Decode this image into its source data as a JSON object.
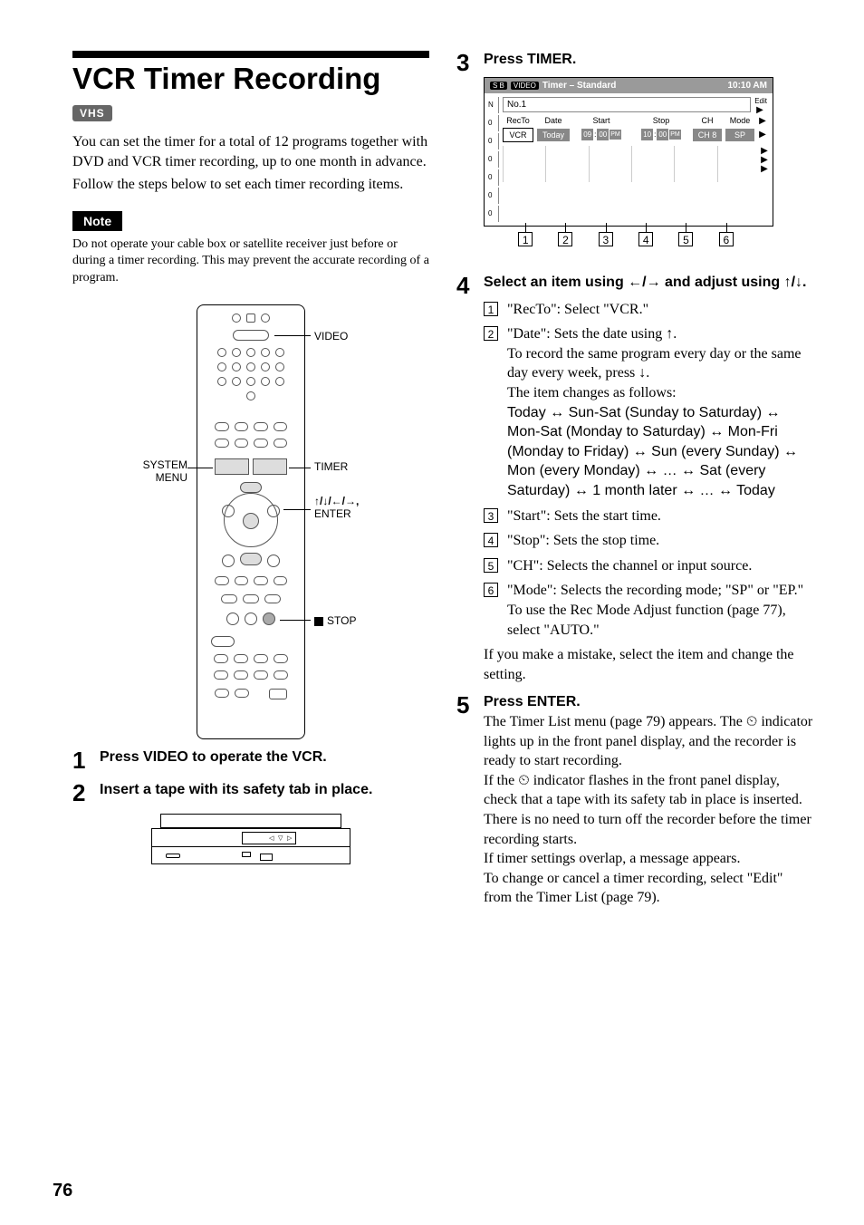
{
  "title": "VCR Timer Recording",
  "vhs_tag": "VHS",
  "intro": {
    "p1": "You can set the timer for a total of 12 programs together with DVD and VCR timer recording, up to one month in advance.",
    "p2": "Follow the steps below to set each timer recording items."
  },
  "note": {
    "label": "Note",
    "text": "Do not operate your cable box or satellite receiver just before or during a timer recording. This may prevent the accurate recording of a program."
  },
  "remote_labels": {
    "video": "VIDEO",
    "system_menu_l1": "SYSTEM",
    "system_menu_l2": "MENU",
    "timer": "TIMER",
    "arrows_enter_l1": "↑/↓/←/→,",
    "arrows_enter_l2": "ENTER",
    "stop": "STOP"
  },
  "steps": {
    "s1": {
      "num": "1",
      "head": "Press VIDEO to operate the VCR."
    },
    "s2": {
      "num": "2",
      "head": "Insert a tape with its safety tab in place."
    },
    "s3": {
      "num": "3",
      "head": "Press TIMER."
    },
    "s4": {
      "num": "4",
      "head": "Select an item using ←/→ and adjust using ↑/↓."
    },
    "s5": {
      "num": "5",
      "head": "Press ENTER.",
      "p1": "The Timer List menu (page 79) appears. The ",
      "p1b": " indicator lights up in the front panel display, and the recorder is ready to start recording.",
      "p2a": "If the ",
      "p2b": " indicator flashes in the front panel display, check that a tape with its safety tab in place is inserted.",
      "p3": "There is no need to turn off the recorder before the timer recording starts.",
      "p4": "If timer settings overlap, a message appears.",
      "p5": "To change or cancel a timer recording, select \"Edit\" from the Timer List (page 79)."
    }
  },
  "timer_screen": {
    "title": "Timer – Standard",
    "clock": "10:10 AM",
    "badge1": "S B",
    "badge2": "VIDEO",
    "row_no": "No.1",
    "col_n": "N",
    "col_zeros": [
      "0",
      "0",
      "0",
      "0",
      "0",
      "0"
    ],
    "edit": "Edit",
    "headers": {
      "recto": "RecTo",
      "date": "Date",
      "start": "Start",
      "stop": "Stop",
      "ch": "CH",
      "mode": "Mode"
    },
    "values": {
      "recto": "VCR",
      "date": "Today",
      "start_h": "09",
      "start_m": "00",
      "start_ap": "PM",
      "stop_h": "10",
      "stop_m": "00",
      "stop_ap": "PM",
      "ch": "CH 8",
      "mode": "SP"
    }
  },
  "callout_nums": [
    "1",
    "2",
    "3",
    "4",
    "5",
    "6"
  ],
  "select_items": {
    "i1": "\"RecTo\": Select \"VCR.\"",
    "i2_line1": "\"Date\": Sets the date using ↑.",
    "i2_line2": "To record the same program every day or the same day every week, press ↓.",
    "i2_line3": "The item changes as follows:",
    "i2_line4": "Today ↔ Sun-Sat (Sunday to Saturday) ↔ Mon-Sat (Monday to Saturday) ↔ Mon-Fri (Monday to Friday) ↔ Sun (every Sunday) ↔ Mon (every Monday) ↔ … ↔ Sat (every Saturday) ↔ 1 month later ↔ … ↔ Today",
    "i3": "\"Start\": Sets the start time.",
    "i4": "\"Stop\": Sets the stop time.",
    "i5": "\"CH\": Selects the channel or input source.",
    "i6": "\"Mode\": Selects the recording mode; \"SP\" or \"EP.\" To use the Rec Mode Adjust function (page 77), select \"AUTO.\"",
    "tail": "If you make a mistake, select the item and change the setting."
  },
  "page_number": "76",
  "clock_icon": "⏲"
}
